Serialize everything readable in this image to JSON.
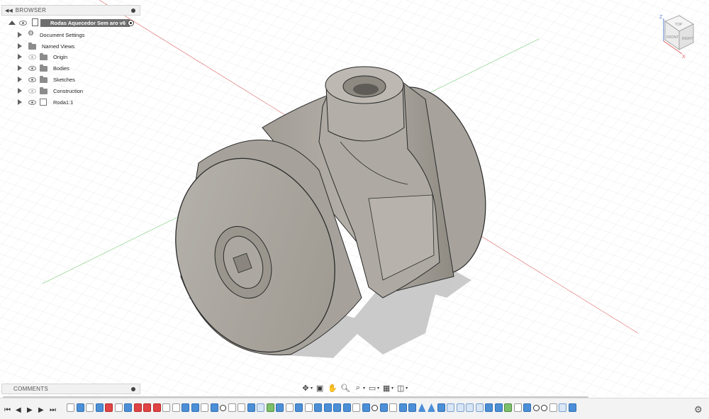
{
  "browser": {
    "title": "BROWSER",
    "root": {
      "label": "Rodas Aquecedor Sem aro v6"
    },
    "items": [
      {
        "label": "Document Settings",
        "icon": "gear-icon",
        "eye": false
      },
      {
        "label": "Named Views",
        "icon": "folder-icon",
        "eye": false
      },
      {
        "label": "Origin",
        "icon": "folder-icon",
        "eye": true,
        "eye_dim": true
      },
      {
        "label": "Bodies",
        "icon": "folder-icon",
        "eye": true,
        "eye_dim": false
      },
      {
        "label": "Sketches",
        "icon": "folder-icon",
        "eye": true,
        "eye_dim": false
      },
      {
        "label": "Construction",
        "icon": "folder-icon",
        "eye": true,
        "eye_dim": true
      },
      {
        "label": "Roda1:1",
        "icon": "component-icon",
        "eye": true,
        "eye_dim": false
      }
    ]
  },
  "comments": {
    "title": "COMMENTS"
  },
  "viewcube": {
    "top": "TOP",
    "front": "FRONT",
    "right": "RIGHT",
    "axis_z": "Z",
    "axis_x": "X"
  },
  "navbar": {
    "tools": [
      "orbit-icon",
      "look-at-icon",
      "pan-icon",
      "zoom-icon",
      "zoom-window-icon",
      "display-settings-icon",
      "grid-settings-icon",
      "viewports-icon"
    ]
  },
  "timeline": {
    "features": [
      "sketch",
      "ext",
      "sketch",
      "ext",
      "red",
      "sketch",
      "ext",
      "red",
      "red",
      "red",
      "sketch",
      "sketch",
      "ext",
      "ext",
      "sketch",
      "ext",
      "joint",
      "sketch",
      "sketch",
      "ext",
      "plane",
      "combo",
      "ext",
      "sketch",
      "ext",
      "sketch",
      "ext",
      "ext",
      "ext",
      "ext",
      "sketch",
      "ext",
      "joint",
      "ext",
      "sketch",
      "ext",
      "ext",
      "tri",
      "tri",
      "ext",
      "plane",
      "plane",
      "plane",
      "plane",
      "ext",
      "ext",
      "combo",
      "sketch",
      "ext",
      "joint",
      "joint",
      "sketch",
      "plane",
      "ext"
    ]
  },
  "colors": {
    "part_body": "#a9a69f",
    "part_shadow": "#c6c6c6",
    "grid_line": "#dcdcdc",
    "axis_red": "#e06a6a",
    "axis_green": "#7fcf7f",
    "root_highlight": "#6e6e6e",
    "timeline_red": "#e04444",
    "timeline_blue": "#4c8fd6"
  }
}
